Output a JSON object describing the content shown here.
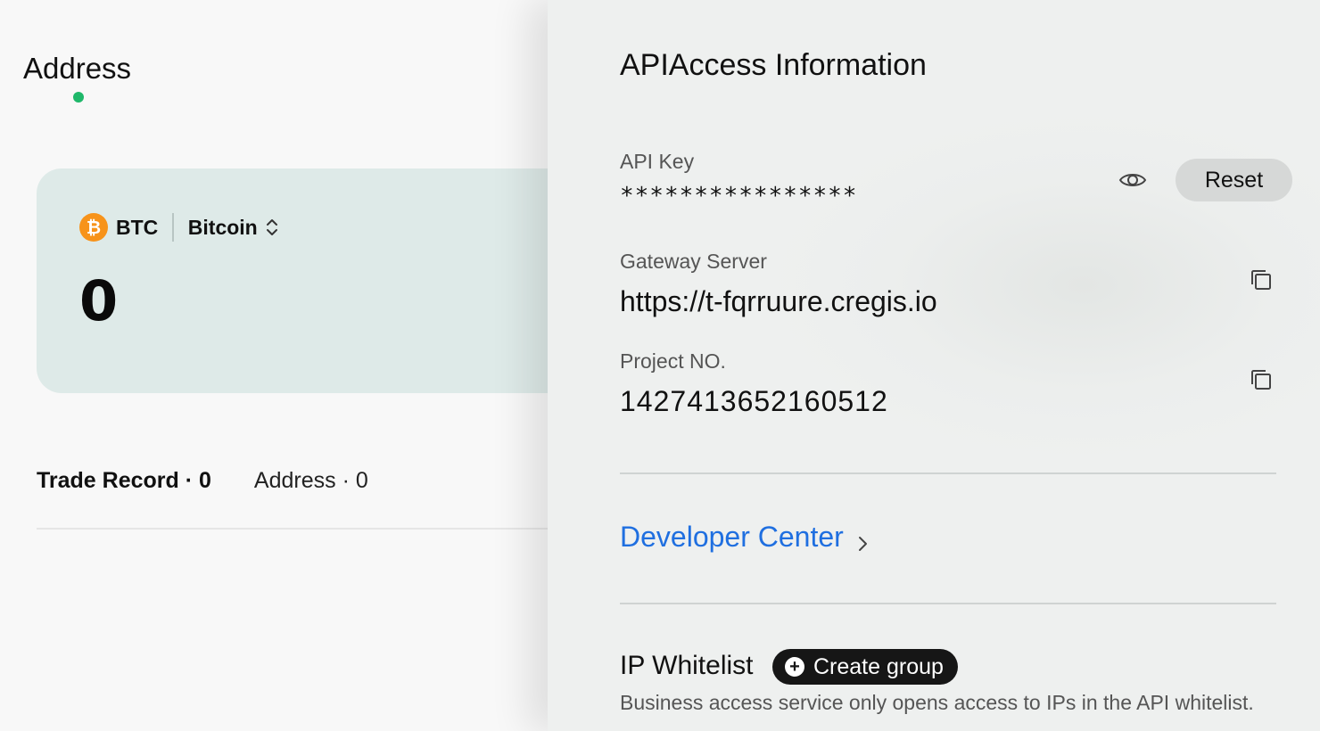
{
  "left": {
    "page_title": "Address",
    "asset": {
      "coin_icon_glyph": "₿",
      "symbol": "BTC",
      "name": "Bitcoin",
      "balance": "0",
      "coin_color": "#f7931a"
    },
    "tabs": [
      {
        "label": "Trade Record · 0",
        "active": true
      },
      {
        "label": "Address · 0",
        "active": false
      }
    ],
    "accent_dot_color": "#1fb86a"
  },
  "right": {
    "title": "APIAccess Information",
    "api_key": {
      "label": "API Key",
      "value": "****************"
    },
    "reset_label": "Reset",
    "gateway": {
      "label": "Gateway Server",
      "value": "https://t-fqrruure.cregis.io"
    },
    "project": {
      "label": "Project NO.",
      "value": "1427413652160512"
    },
    "developer_center_label": "Developer Center",
    "link_color": "#1f6fe0",
    "ip_whitelist": {
      "title": "IP Whitelist",
      "create_label": "Create group",
      "plus_glyph": "+",
      "description": "Business access service only opens access to IPs in the API whitelist."
    }
  },
  "icons": {
    "eye": "eye-icon",
    "copy": "copy-icon",
    "chevron": "chevron-right-icon",
    "switch": "sort-switch-icon",
    "coin": "bitcoin-icon",
    "plus": "plus-circle-icon"
  }
}
